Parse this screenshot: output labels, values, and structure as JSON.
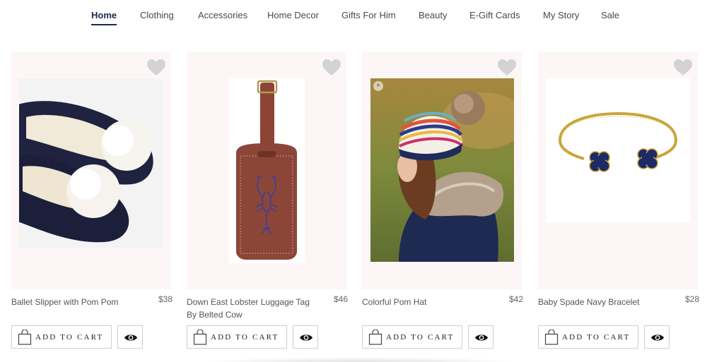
{
  "nav": {
    "items": [
      {
        "label": "Home",
        "active": true
      },
      {
        "label": "Clothing"
      },
      {
        "label": "Accessories"
      },
      {
        "label": "Home Decor"
      },
      {
        "label": "Gifts For Him"
      },
      {
        "label": "Beauty"
      },
      {
        "label": "E-Gift Cards"
      },
      {
        "label": "My Story"
      },
      {
        "label": "Sale"
      }
    ]
  },
  "products": [
    {
      "name": "Ballet Slipper with Pom Pom",
      "price": "$38",
      "image": "slipper-image",
      "add_label": "ADD TO CART"
    },
    {
      "name": "Down East Lobster Luggage Tag By Belted Cow",
      "price": "$46",
      "image": "luggage-tag-image",
      "add_label": "ADD TO CART"
    },
    {
      "name": "Colorful Pom Hat",
      "price": "$42",
      "image": "pom-hat-image",
      "add_label": "ADD TO CART"
    },
    {
      "name": "Baby Spade Navy Bracelet",
      "price": "$28",
      "image": "bracelet-image",
      "add_label": "ADD TO CART"
    }
  ],
  "colors": {
    "nav_active": "#1c2b4a",
    "card_bg": "#fdf6f7",
    "heart": "#d3d3d3"
  },
  "icons": {
    "wishlist": "heart-icon",
    "cart": "shopping-bag-icon",
    "quick_view": "eye-icon",
    "close": "close-icon"
  }
}
